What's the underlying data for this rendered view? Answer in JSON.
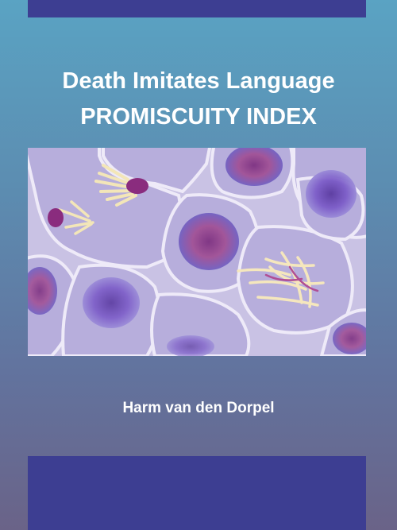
{
  "cover": {
    "title_line1": "Death Imitates Language",
    "title_line2": "PROMISCUITY INDEX",
    "author": "Harm van den Dorpel"
  },
  "colors": {
    "band": "#3d3e92",
    "background_top": "#5aa3c3",
    "background_bottom": "#6a6388",
    "text": "#ffffff"
  },
  "image": {
    "subject": "micrograph of dividing cells with purple stained nuclei and chromosomes"
  }
}
